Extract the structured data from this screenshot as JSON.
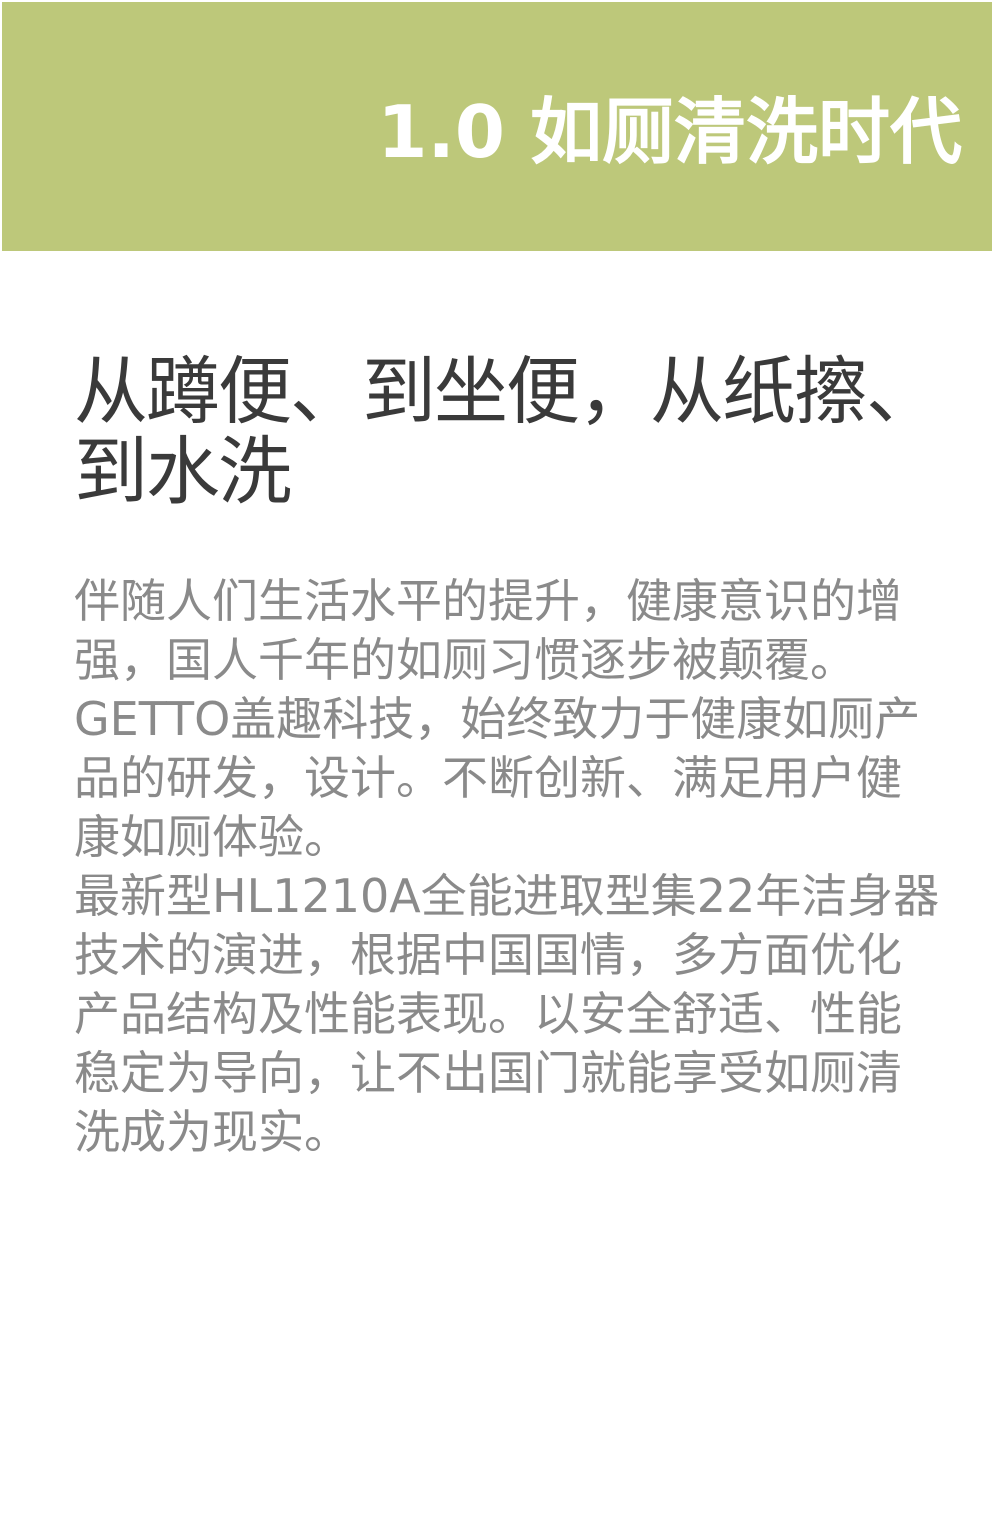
{
  "header": {
    "title": "1.0 如厕清洗时代",
    "band_color": "#bdc87a"
  },
  "headline": {
    "line1": "从蹲便、到坐便，从纸擦、",
    "line2": "到水洗"
  },
  "body": {
    "paragraphs": [
      "伴随人们生活水平的提升，健康意识的增强，国人千年的如厕习惯逐步被颠覆。GETTO盖趣科技，始终致力于健康如厕产品的研发，设计。不断创新、满足用户健康如厕体验。",
      "最新型HL1210A全能进取型集22年洁身器技术的演进，根据中国国情，多方面优化产品结构及性能表现。以安全舒适、性能稳定为导向，让不出国门就能享受如厕清洗成为现实。"
    ]
  }
}
